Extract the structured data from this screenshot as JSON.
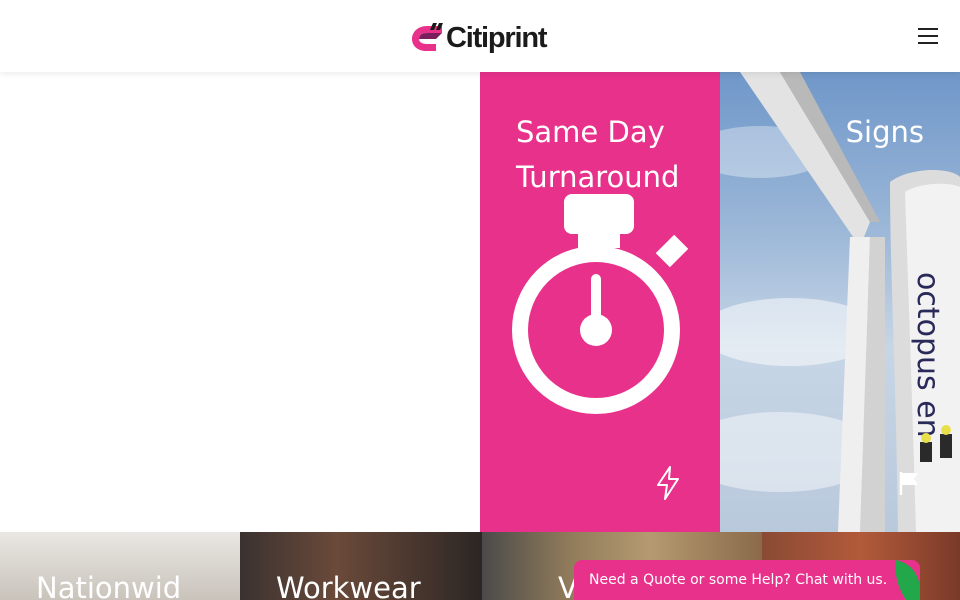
{
  "header": {
    "brand_name": "Citiprint",
    "menu_icon": "hamburger-menu-icon"
  },
  "tiles": {
    "same_day": {
      "title": "Same Day Turnaround",
      "icon": "stopwatch-icon",
      "badge_icon": "lightning-bolt-icon",
      "background": "#e8318a"
    },
    "signs": {
      "title": "Signs",
      "photo_text": "octopus en",
      "badge_icon": "flag-icon"
    }
  },
  "bottom_tiles": [
    {
      "title": "Nationwid"
    },
    {
      "title": "Workwear"
    },
    {
      "title": "V"
    }
  ],
  "chat": {
    "label": "Need a Quote or some Help? Chat with us.",
    "accent": "#e8318a"
  },
  "colors": {
    "brand_pink": "#e8318a",
    "text_dark": "#1b1b1b"
  }
}
